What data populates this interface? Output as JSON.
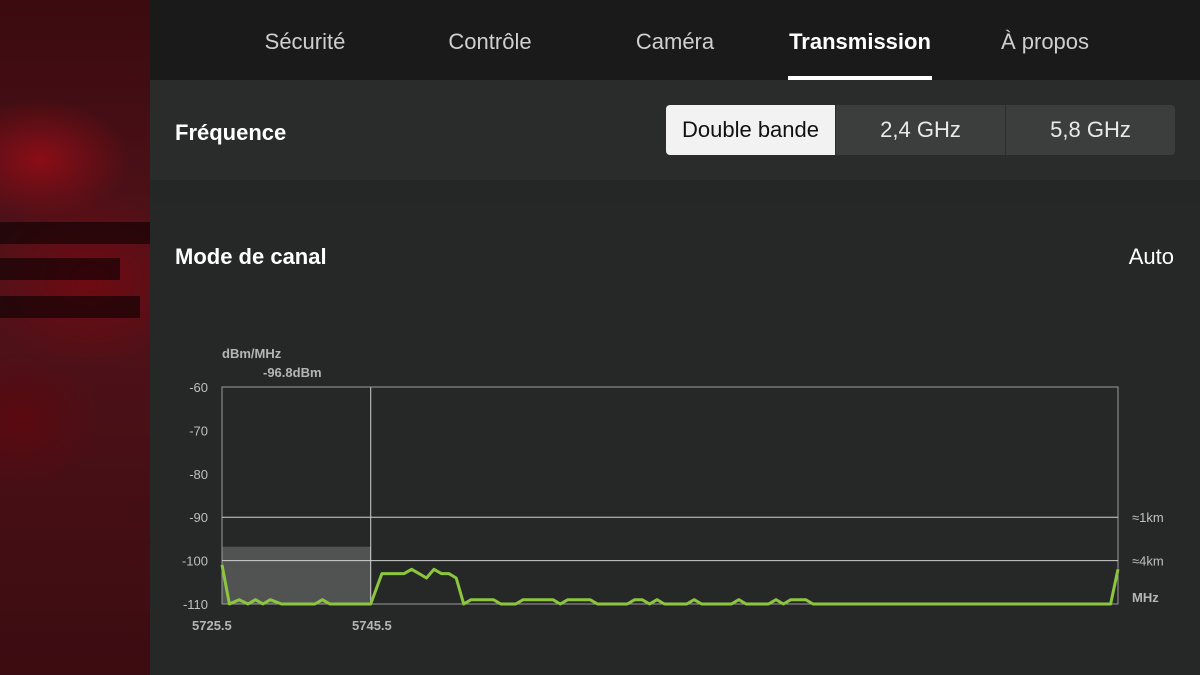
{
  "tabs": [
    {
      "label": "Sécurité",
      "active": false
    },
    {
      "label": "Contrôle",
      "active": false
    },
    {
      "label": "Caméra",
      "active": false
    },
    {
      "label": "Transmission",
      "active": true
    },
    {
      "label": "À propos",
      "active": false
    }
  ],
  "frequency": {
    "title": "Fréquence",
    "options": [
      "Double bande",
      "2,4 GHz",
      "5,8 GHz"
    ],
    "selected": "Double bande"
  },
  "channel_mode": {
    "title": "Mode de canal",
    "value": "Auto"
  },
  "colors": {
    "signal_line": "#8cc63f",
    "selected_segment_bg": "#f2f2f2",
    "grid": "#cfcfcf"
  },
  "chart_data": {
    "type": "line",
    "ylabel": "dBm/MHz",
    "xlabel": "MHz",
    "ylim": [
      -110,
      -60
    ],
    "yticks": [
      "-60",
      "-70",
      "-80",
      "-90",
      "-100",
      "-110"
    ],
    "xticks": [
      "5725.5",
      "5745.5"
    ],
    "reference_lines": [
      {
        "value": -90,
        "label": "≈1km"
      },
      {
        "value": -100,
        "label": "≈4km"
      }
    ],
    "selected_channel": {
      "range": [
        5725.5,
        5745.5
      ],
      "level": -96.8,
      "label": "-96.8dBm"
    },
    "series": [
      {
        "x": [
          5725.5,
          5726.5,
          5727.8,
          5729,
          5730,
          5731,
          5732,
          5733.5,
          5735,
          5736.5,
          5738,
          5739,
          5740,
          5741,
          5742,
          5743,
          5744,
          5745.5,
          5747,
          5748,
          5749,
          5750,
          5751,
          5752,
          5753,
          5754,
          5755,
          5756,
          5757,
          5758,
          5759,
          5760,
          5761,
          5762,
          5763,
          5764,
          5765,
          5766,
          5767,
          5768,
          5769,
          5770,
          5771,
          5772,
          5773,
          5774,
          5775,
          5776,
          5777,
          5778,
          5779,
          5780,
          5781,
          5782,
          5783,
          5784,
          5785,
          5786,
          5787,
          5788,
          5789,
          5790,
          5791,
          5792,
          5793,
          5794,
          5795,
          5796,
          5797,
          5798,
          5799,
          5800,
          5801,
          5802,
          5803,
          5804,
          5805,
          5806,
          5807,
          5808,
          5809,
          5810,
          5811,
          5812,
          5813,
          5814,
          5815,
          5816,
          5817,
          5818,
          5819,
          5820,
          5821,
          5822,
          5823,
          5824,
          5825,
          5826,
          5827,
          5828,
          5829,
          5830,
          5831,
          5832,
          5833,
          5834,
          5835,
          5836,
          5837,
          5838,
          5839,
          5840,
          5841,
          5842,
          5843,
          5844,
          5845,
          5846
        ],
        "y": [
          -101,
          -110,
          -109,
          -110,
          -109,
          -110,
          -109,
          -110,
          -110,
          -110,
          -110,
          -109,
          -110,
          -110,
          -110,
          -110,
          -110,
          -110,
          -103,
          -103,
          -103,
          -103,
          -102,
          -103,
          -104,
          -102,
          -103,
          -103,
          -104,
          -110,
          -109,
          -109,
          -109,
          -109,
          -110,
          -110,
          -110,
          -109,
          -109,
          -109,
          -109,
          -109,
          -110,
          -109,
          -109,
          -109,
          -109,
          -110,
          -110,
          -110,
          -110,
          -110,
          -109,
          -109,
          -110,
          -109,
          -110,
          -110,
          -110,
          -110,
          -109,
          -110,
          -110,
          -110,
          -110,
          -110,
          -109,
          -110,
          -110,
          -110,
          -110,
          -109,
          -110,
          -109,
          -109,
          -109,
          -110,
          -110,
          -110,
          -110,
          -110,
          -110,
          -110,
          -110,
          -110,
          -110,
          -110,
          -110,
          -110,
          -110,
          -110,
          -110,
          -110,
          -110,
          -110,
          -110,
          -110,
          -110,
          -110,
          -110,
          -110,
          -110,
          -110,
          -110,
          -110,
          -110,
          -110,
          -110,
          -110,
          -110,
          -110,
          -110,
          -110,
          -110,
          -110,
          -110,
          -110,
          -102
        ]
      }
    ]
  }
}
